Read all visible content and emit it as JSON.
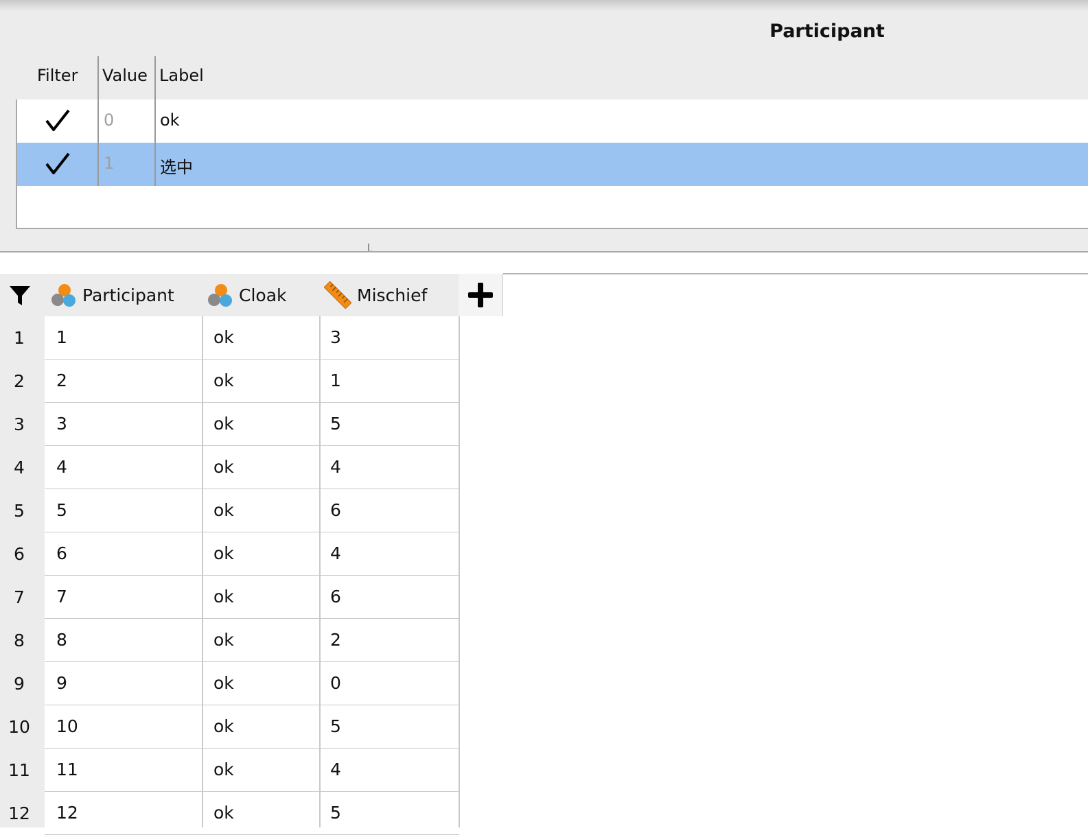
{
  "label_editor": {
    "variable_title": "Participant",
    "headers": {
      "filter": "Filter",
      "value": "Value",
      "label": "Label"
    },
    "rows": [
      {
        "filter_checked": true,
        "value": "0",
        "label": "ok",
        "selected": false
      },
      {
        "filter_checked": true,
        "value": "1",
        "label": "选中",
        "selected": true
      }
    ]
  },
  "sheet": {
    "columns": [
      {
        "name": "Participant",
        "icon": "nominal-icon"
      },
      {
        "name": "Cloak",
        "icon": "nominal-icon"
      },
      {
        "name": "Mischief",
        "icon": "continuous-ruler-icon"
      }
    ],
    "rows": [
      {
        "n": "1",
        "participant": "1",
        "cloak": "ok",
        "mischief": "3"
      },
      {
        "n": "2",
        "participant": "2",
        "cloak": "ok",
        "mischief": "1"
      },
      {
        "n": "3",
        "participant": "3",
        "cloak": "ok",
        "mischief": "5"
      },
      {
        "n": "4",
        "participant": "4",
        "cloak": "ok",
        "mischief": "4"
      },
      {
        "n": "5",
        "participant": "5",
        "cloak": "ok",
        "mischief": "6"
      },
      {
        "n": "6",
        "participant": "6",
        "cloak": "ok",
        "mischief": "4"
      },
      {
        "n": "7",
        "participant": "7",
        "cloak": "ok",
        "mischief": "6"
      },
      {
        "n": "8",
        "participant": "8",
        "cloak": "ok",
        "mischief": "2"
      },
      {
        "n": "9",
        "participant": "9",
        "cloak": "ok",
        "mischief": "0"
      },
      {
        "n": "10",
        "participant": "10",
        "cloak": "ok",
        "mischief": "5"
      },
      {
        "n": "11",
        "participant": "11",
        "cloak": "ok",
        "mischief": "4"
      },
      {
        "n": "12",
        "participant": "12",
        "cloak": "ok",
        "mischief": "5"
      }
    ]
  },
  "colors": {
    "selected_row": "#9bc3f1",
    "panel_bg": "#ececec"
  }
}
